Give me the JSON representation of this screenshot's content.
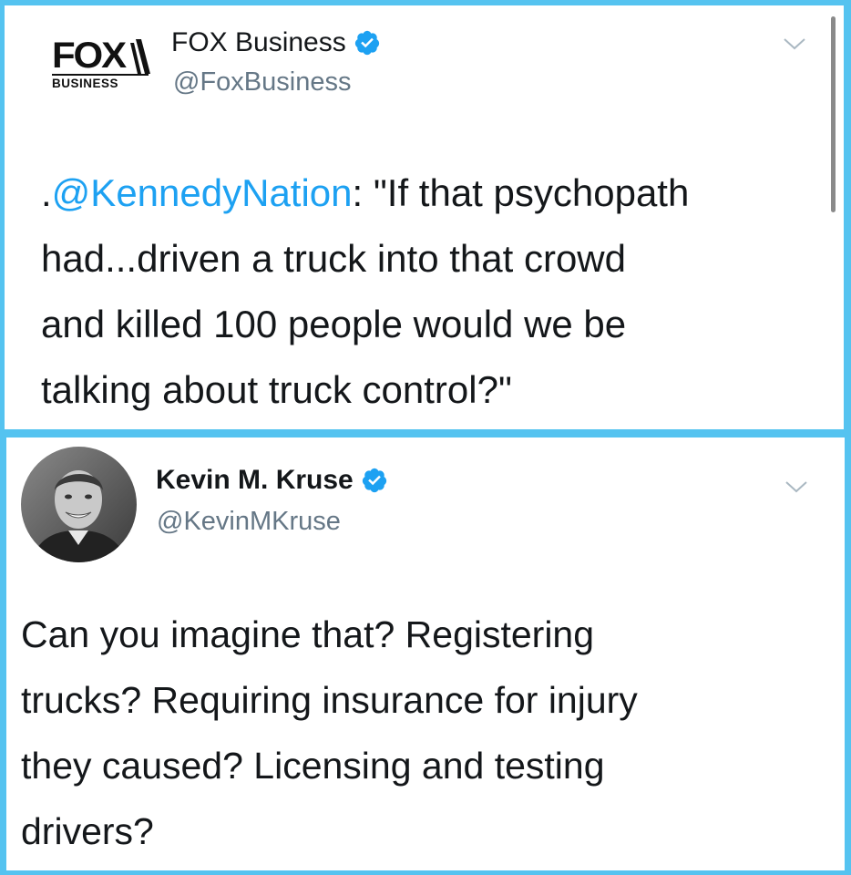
{
  "tweet1": {
    "name": "FOX Business",
    "handle": "@FoxBusiness",
    "logo_word": "FOX",
    "logo_sub": "BUSINESS",
    "verified": true,
    "body_prefix": ".",
    "mention": "@KennedyNation",
    "body_line1_rest": ": \"If that psychopath",
    "body_line2": "had...driven a truck into that crowd",
    "body_line3": "and killed 100 people would we be",
    "body_line4": "talking about truck control?\""
  },
  "tweet2": {
    "name": "Kevin M. Kruse",
    "handle": "@KevinMKruse",
    "verified": true,
    "body_line1": "Can you imagine that? Registering",
    "body_line2": "trucks? Requiring insurance for injury",
    "body_line3": "they caused? Licensing and testing",
    "body_line4": "drivers?"
  },
  "colors": {
    "border": "#55c3f0",
    "verified": "#1da1f2",
    "mention": "#1da1f2",
    "handle": "#657786"
  },
  "icons": [
    "verified-badge-icon",
    "chevron-down-icon",
    "fox-business-logo",
    "avatar"
  ]
}
